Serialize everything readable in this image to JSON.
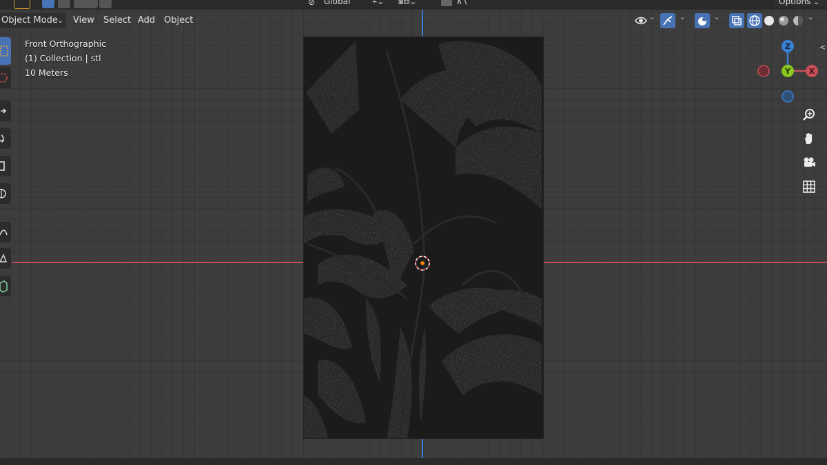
{
  "header": {
    "mode": "Object Mode",
    "menus": [
      "View",
      "Select",
      "Add",
      "Object"
    ],
    "transform_orientation": "Global",
    "options_label": "Options"
  },
  "overlay": {
    "view_name": "Front Orthographic",
    "collection": "(1) Collection | stl",
    "scale": "10 Meters"
  },
  "gizmo": {
    "z": "Z",
    "y": "Y",
    "x": "X"
  },
  "colors": {
    "accent": "#4772b3",
    "x_axis": "#c7505a",
    "y_axis": "#8bc520",
    "z_axis": "#3a7fd1",
    "origin": "#ff8c00"
  },
  "toolbar_icons": [
    "select-box-icon",
    "cursor-icon",
    "move-icon",
    "rotate-icon",
    "scale-icon",
    "transform-icon",
    "annotate-icon",
    "measure-icon",
    "add-cube-icon"
  ],
  "nav_icons": [
    "zoom-icon",
    "hand-pan-icon",
    "camera-icon",
    "grid-view-icon"
  ]
}
